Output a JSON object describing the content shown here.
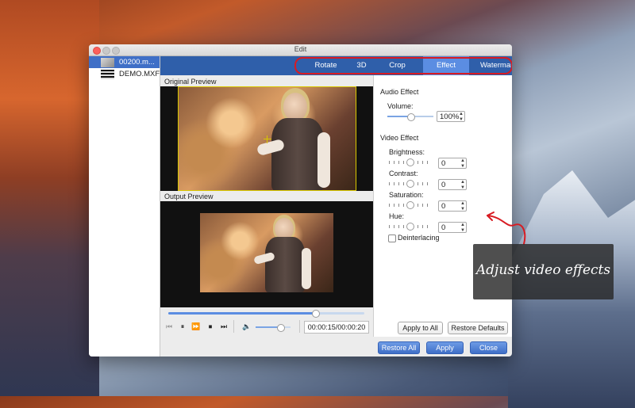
{
  "window": {
    "title": "Edit"
  },
  "sidebar": {
    "files": [
      {
        "name": "00200.m...",
        "selected": true
      },
      {
        "name": "DEMO.MXF",
        "selected": false
      }
    ]
  },
  "tabs": [
    {
      "label": "Rotate",
      "active": false
    },
    {
      "label": "3D",
      "active": false
    },
    {
      "label": "Crop",
      "active": false
    },
    {
      "label": "Effect",
      "active": true
    },
    {
      "label": "Watermark",
      "active": false
    }
  ],
  "preview": {
    "original_label": "Original Preview",
    "output_label": "Output Preview"
  },
  "player": {
    "time": "00:00:15/00:00:20",
    "progress": 0.75,
    "volume": 0.7,
    "buttons": [
      "skip-back-icon",
      "pause-icon",
      "fast-forward-icon",
      "stop-icon",
      "skip-forward-icon",
      "speaker-icon"
    ]
  },
  "audio": {
    "heading": "Audio Effect",
    "volume_label": "Volume:",
    "volume_value": "100%",
    "volume_level": 0.5
  },
  "video": {
    "heading": "Video Effect",
    "brightness_label": "Brightness:",
    "brightness_value": "0",
    "contrast_label": "Contrast:",
    "contrast_value": "0",
    "saturation_label": "Saturation:",
    "saturation_value": "0",
    "hue_label": "Hue:",
    "hue_value": "0",
    "deinterlacing_label": "Deinterlacing",
    "deinterlacing_checked": false
  },
  "actions": {
    "apply_to_all": "Apply to All",
    "restore_defaults": "Restore Defaults",
    "restore_all": "Restore All",
    "apply": "Apply",
    "close": "Close"
  },
  "callout": {
    "text": "Adjust video effects"
  },
  "colors": {
    "tabbar": "#2f5faa",
    "tab_active": "#5b8de2",
    "highlight_outline": "#d81b22",
    "selection": "#3f6fc7",
    "crop_frame": "#d9c800"
  }
}
